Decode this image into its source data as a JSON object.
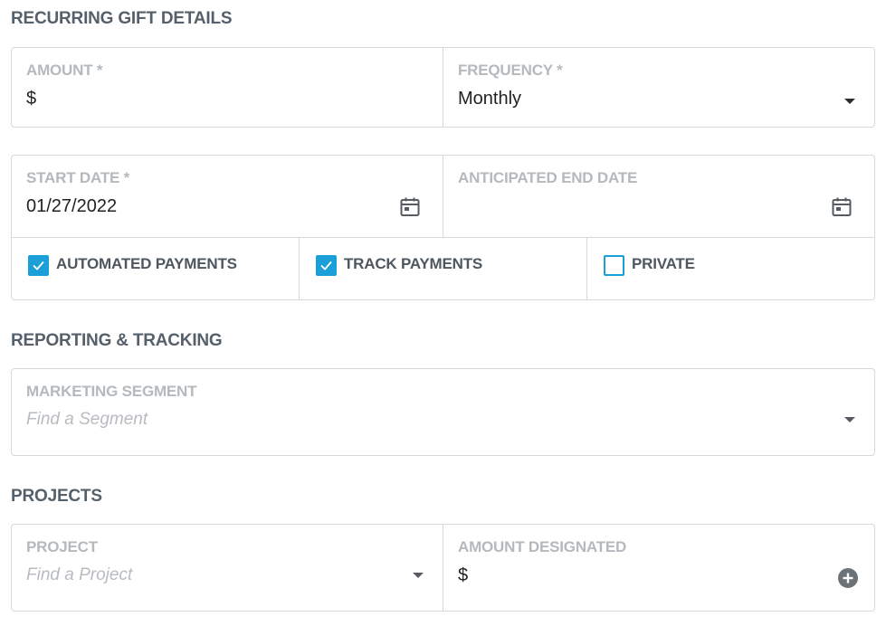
{
  "recurring": {
    "title": "RECURRING GIFT DETAILS",
    "amount": {
      "label": "AMOUNT *",
      "value": "$"
    },
    "frequency": {
      "label": "FREQUENCY *",
      "value": "Monthly"
    },
    "start_date": {
      "label": "START DATE *",
      "value": "01/27/2022"
    },
    "end_date": {
      "label": "ANTICIPATED END DATE",
      "value": ""
    },
    "checkboxes": [
      {
        "label": "AUTOMATED PAYMENTS",
        "checked": true
      },
      {
        "label": "TRACK PAYMENTS",
        "checked": true
      },
      {
        "label": "PRIVATE",
        "checked": false
      }
    ]
  },
  "reporting": {
    "title": "REPORTING & TRACKING",
    "segment": {
      "label": "MARKETING SEGMENT",
      "placeholder": "Find a Segment"
    }
  },
  "projects": {
    "title": "PROJECTS",
    "project": {
      "label": "PROJECT",
      "placeholder": "Find a Project"
    },
    "amount_designated": {
      "label": "AMOUNT DESIGNATED",
      "value": "$"
    }
  },
  "icons": {
    "calendar": "calendar-icon",
    "dropdown": "chevron-down-icon",
    "add": "plus-circle-icon"
  },
  "colors": {
    "accent": "#1a9fd9",
    "heading": "#56606b",
    "label": "#b4b9be",
    "border": "#d6d9dc"
  }
}
